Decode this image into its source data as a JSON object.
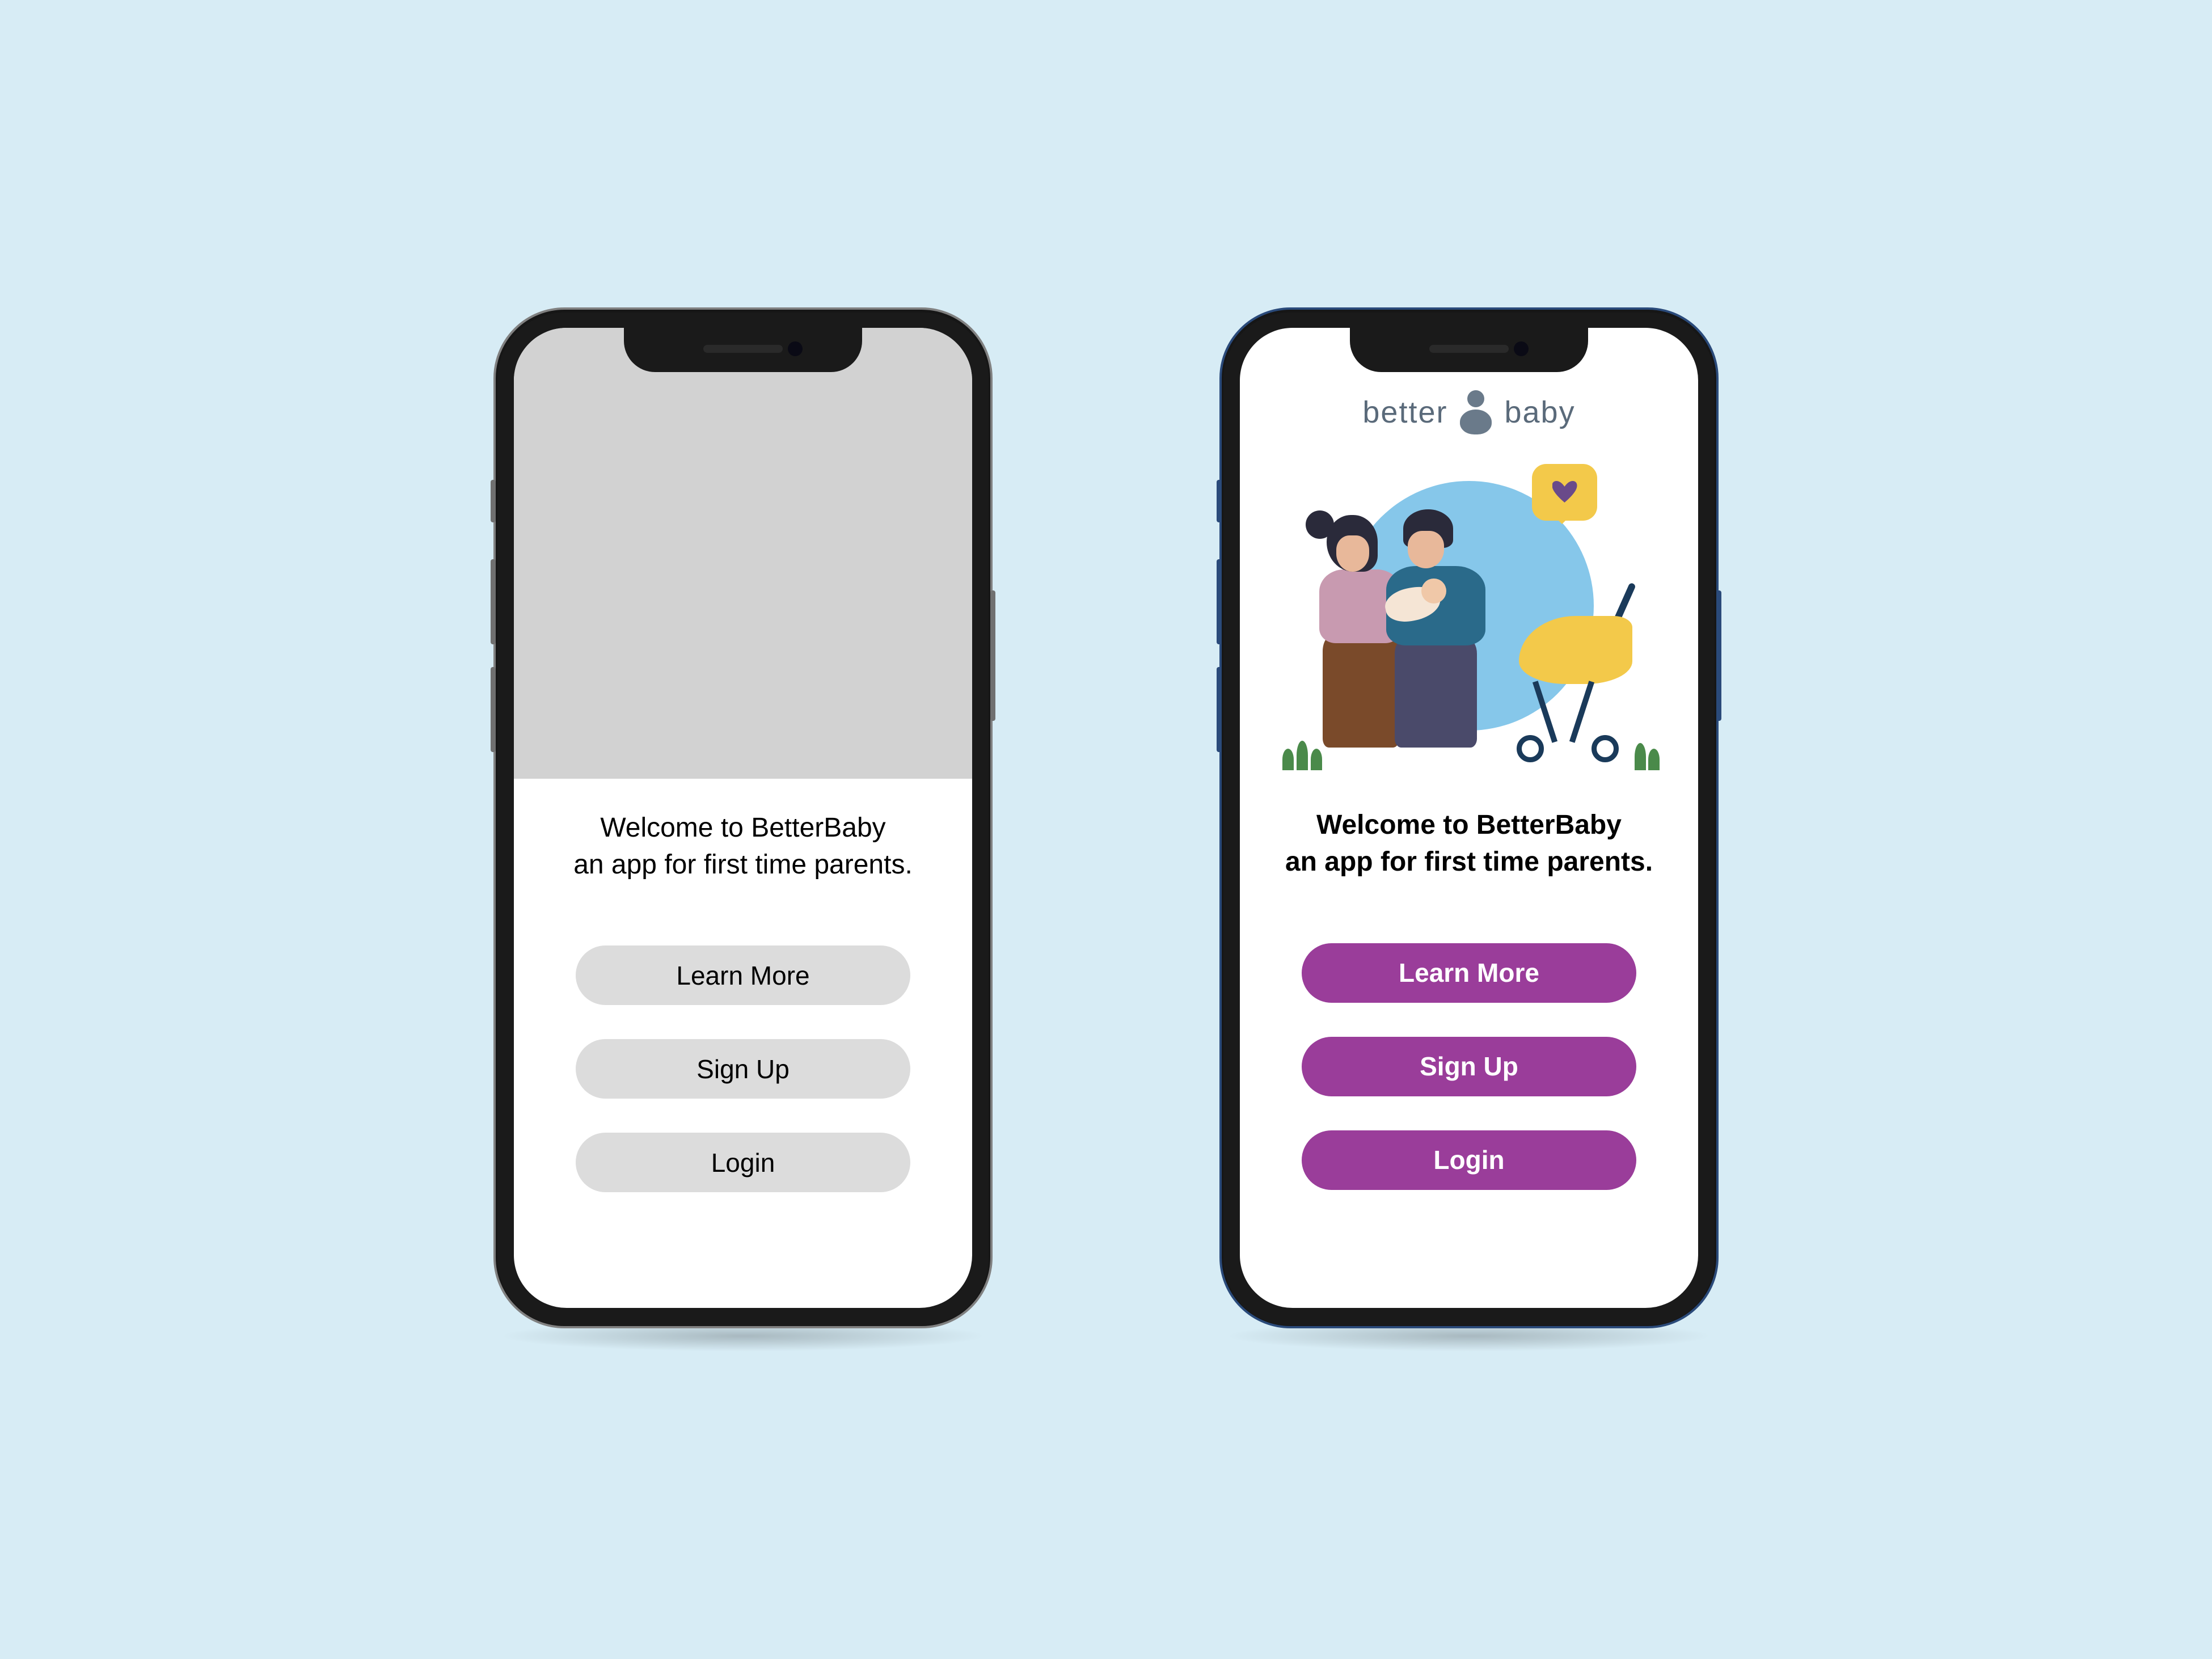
{
  "wireframe": {
    "welcome_line1": "Welcome to BetterBaby",
    "welcome_line2": "an app for first time parents.",
    "buttons": {
      "learn_more": "Learn More",
      "sign_up": "Sign Up",
      "login": "Login"
    }
  },
  "final": {
    "logo": {
      "text_left": "better",
      "text_right": "baby",
      "icon_name": "baby-figure-icon"
    },
    "illustration_name": "parents-with-baby-and-stroller",
    "welcome_line1": "Welcome to BetterBaby",
    "welcome_line2": "an app for first time parents.",
    "buttons": {
      "learn_more": "Learn More",
      "sign_up": "Sign Up",
      "login": "Login"
    }
  },
  "colors": {
    "background": "#d7ecf5",
    "wireframe_button": "#dcdcdc",
    "final_button": "#9a3d9a",
    "logo_text": "#5a6a7a",
    "accent_yellow": "#f3c94a",
    "accent_blue": "#86c7ea"
  }
}
